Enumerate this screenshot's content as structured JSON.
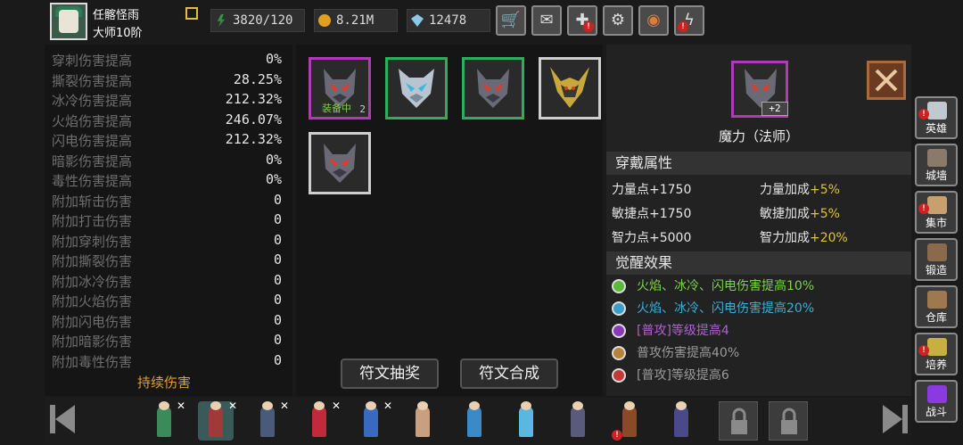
{
  "player": {
    "name": "任髂怪雨",
    "rank": "大师10阶"
  },
  "resources": {
    "stamina": "3820/120",
    "gold": "8.21M",
    "gems": "12478"
  },
  "top_buttons": [
    {
      "name": "shop",
      "icon": "cart-icon"
    },
    {
      "name": "mail",
      "icon": "mail-icon"
    },
    {
      "name": "controller",
      "icon": "gamepad-icon"
    },
    {
      "name": "settings",
      "icon": "gear-icon"
    },
    {
      "name": "color-wheel",
      "icon": "palette-icon"
    },
    {
      "name": "energy",
      "icon": "lightning-icon"
    }
  ],
  "stats": [
    {
      "label": "穿刺伤害提高",
      "value": "0%"
    },
    {
      "label": "撕裂伤害提高",
      "value": "28.25%"
    },
    {
      "label": "冰冷伤害提高",
      "value": "212.32%"
    },
    {
      "label": "火焰伤害提高",
      "value": "246.07%"
    },
    {
      "label": "闪电伤害提高",
      "value": "212.32%"
    },
    {
      "label": "暗影伤害提高",
      "value": "0%"
    },
    {
      "label": "毒性伤害提高",
      "value": "0%"
    },
    {
      "label": "附加斩击伤害",
      "value": "0"
    },
    {
      "label": "附加打击伤害",
      "value": "0"
    },
    {
      "label": "附加穿刺伤害",
      "value": "0"
    },
    {
      "label": "附加撕裂伤害",
      "value": "0"
    },
    {
      "label": "附加冰冷伤害",
      "value": "0"
    },
    {
      "label": "附加火焰伤害",
      "value": "0"
    },
    {
      "label": "附加闪电伤害",
      "value": "0"
    },
    {
      "label": "附加暗影伤害",
      "value": "0"
    },
    {
      "label": "附加毒性伤害",
      "value": "0"
    }
  ],
  "sustained_damage_label": "持续伤害",
  "runes": {
    "equipped_label": "装备中",
    "slot1_level": "2",
    "draw_label": "符文抽奖",
    "combine_label": "符文合成"
  },
  "detail": {
    "level": "+2",
    "name": "魔力（法师）",
    "wear_section": "穿戴属性",
    "attributes": [
      {
        "label": "力量点+1750"
      },
      {
        "label": "力量加成",
        "bonus": "+5%"
      },
      {
        "label": "敏捷点+1750"
      },
      {
        "label": "敏捷加成",
        "bonus": "+5%"
      },
      {
        "label": "智力点+5000"
      },
      {
        "label": "智力加成",
        "bonus": "+20%"
      }
    ],
    "awaken_section": "觉醒效果",
    "awakenings": [
      {
        "text": "火焰、冰冷、闪电伤害提高10%",
        "color": "#7cd24a",
        "dot": "#5ab83a"
      },
      {
        "text": "火焰、冰冷、闪电伤害提高20%",
        "color": "#3aaed8",
        "dot": "#3a9ec8"
      },
      {
        "text": "[普攻]等级提高4",
        "color": "#b060d0",
        "dot": "#8a3ab8"
      },
      {
        "text": "普攻伤害提高40%",
        "color": "#9a9a9a",
        "dot": "#b8823a"
      },
      {
        "text": "[普攻]等级提高6",
        "color": "#9a9a9a",
        "dot": "#c03a3a"
      }
    ]
  },
  "side_nav": [
    {
      "label": "英雄",
      "icon": "helmet-icon"
    },
    {
      "label": "城墙",
      "icon": "wall-icon"
    },
    {
      "label": "集市",
      "icon": "market-icon"
    },
    {
      "label": "锻造",
      "icon": "anvil-icon"
    },
    {
      "label": "仓库",
      "icon": "storage-icon"
    },
    {
      "label": "培养",
      "icon": "trophy-icon"
    },
    {
      "label": "战斗",
      "icon": "portal-icon"
    }
  ],
  "colors": {
    "accent_gold": "#e0a030",
    "rare_purple": "#b03ab8",
    "uncommon_green": "#2fae5a"
  }
}
